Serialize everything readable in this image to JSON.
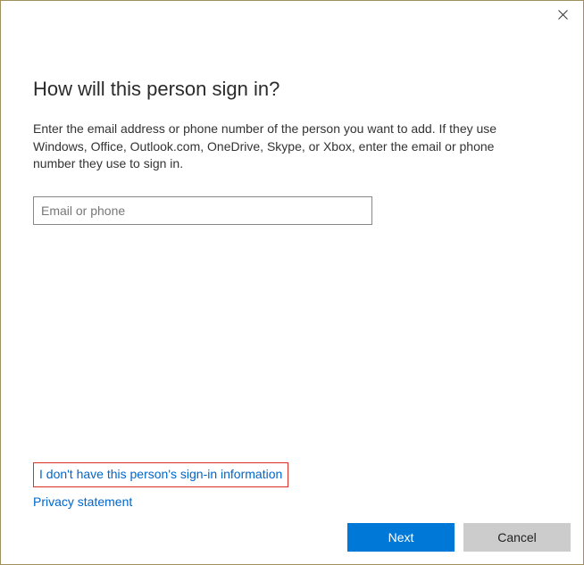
{
  "dialog": {
    "heading": "How will this person sign in?",
    "description": "Enter the email address or phone number of the person you want to add. If they use Windows, Office, Outlook.com, OneDrive, Skype, or Xbox, enter the email or phone number they use to sign in.",
    "input": {
      "placeholder": "Email or phone",
      "value": ""
    },
    "links": {
      "no_info": "I don't have this person's sign-in information",
      "privacy": "Privacy statement"
    },
    "buttons": {
      "next": "Next",
      "cancel": "Cancel"
    }
  }
}
